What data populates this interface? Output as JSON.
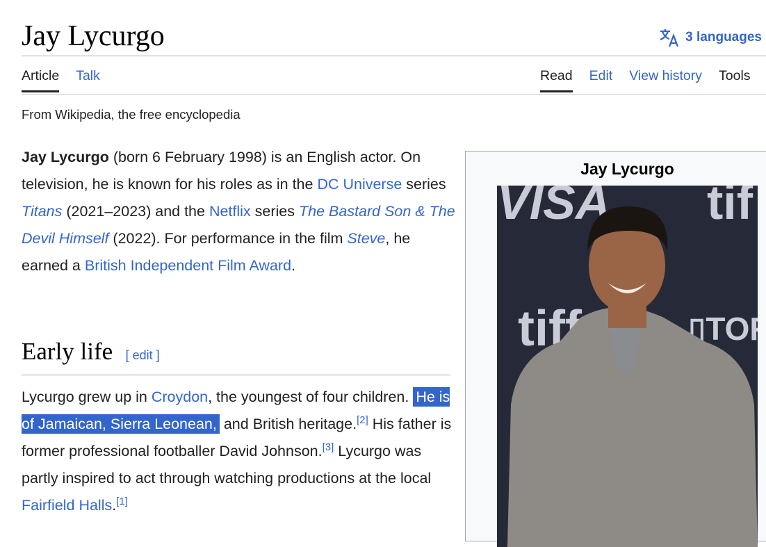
{
  "page": {
    "title": "Jay Lycurgo",
    "languages_label": "3 languages",
    "tagline": "From Wikipedia, the free encyclopedia"
  },
  "tabs_left": [
    {
      "label": "Article"
    },
    {
      "label": "Talk"
    }
  ],
  "tabs_right": [
    {
      "label": "Read"
    },
    {
      "label": "Edit"
    },
    {
      "label": "View history"
    },
    {
      "label": "Tools"
    }
  ],
  "intro": {
    "s1_bold": "Jay Lycurgo",
    "s2": " (born 6 February 1998) is an English actor. On television, he is known for his roles as in the ",
    "l1": "DC Universe",
    "s3": " series ",
    "l2": "Titans",
    "s4": " (2021–2023) and the ",
    "l3": "Netflix",
    "s5": " series ",
    "l4": "The Bastard Son & The Devil Himself",
    "s6": " (2022). For performance in the film ",
    "l5": "Steve",
    "s7": ", he earned a ",
    "l6": "British Independent Film Award",
    "s8": "."
  },
  "section": {
    "heading": "Early life",
    "edit_label": "[ edit ]"
  },
  "early_life": {
    "s1": "Lycurgo grew up in ",
    "l1": "Croydon",
    "s2": ", the youngest of four children. ",
    "selected": "He is of Jamaican, Sierra Leonean,",
    "s3": " and British heritage.",
    "ref1": "[2]",
    "s4": " His father is former professional footballer David Johnson.",
    "ref2": "[3]",
    "s5": " Lycurgo was partly inspired to act through watching productions at the local ",
    "l2": "Fairfield Halls",
    "s6": ".",
    "ref3": "[1]"
  },
  "infobox": {
    "title": "Jay Lycurgo"
  },
  "colors": {
    "link": "#3366cc",
    "selection": "#3366cc"
  }
}
